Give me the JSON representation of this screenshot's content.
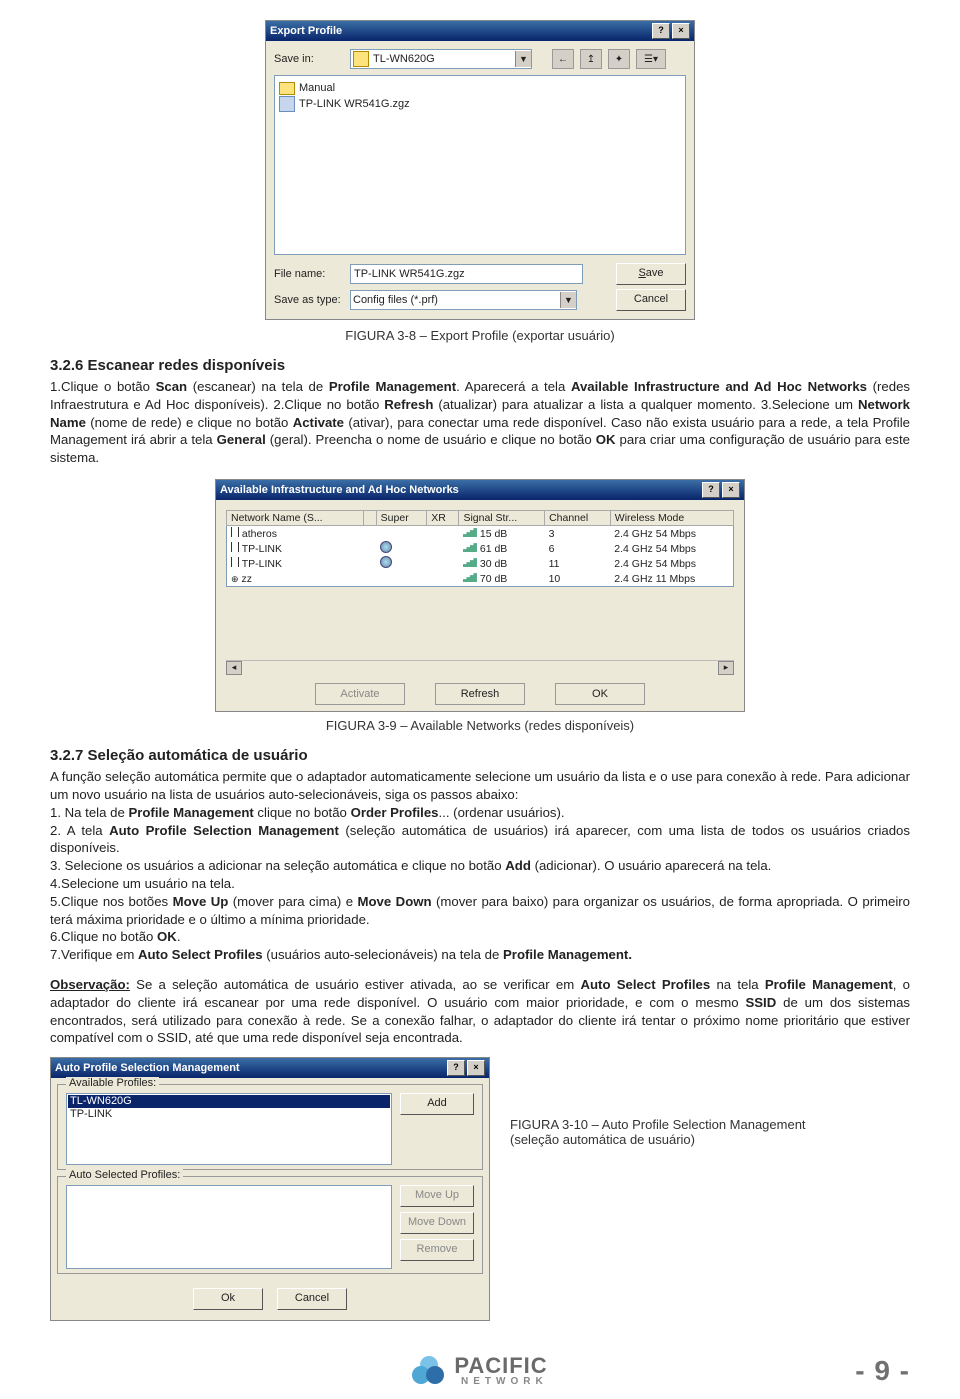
{
  "fig38": {
    "title": "Export Profile",
    "savein_label": "Save in:",
    "savein_value": "TL-WN620G",
    "files": [
      {
        "type": "folder",
        "name": "Manual"
      },
      {
        "type": "cfg",
        "name": "TP-LINK WR541G.zgz"
      }
    ],
    "filename_label": "File name:",
    "filename_value": "TP-LINK WR541G.zgz",
    "saveastype_label": "Save as type:",
    "saveastype_value": "Config files (*.prf)",
    "save_btn": "Save",
    "cancel_btn": "Cancel",
    "help_btn": "?",
    "close_btn": "×"
  },
  "caption38": "FIGURA 3-8 – Export Profile (exportar usuário)",
  "h326": "3.2.6 Escanear redes disponíveis",
  "p326": [
    "1.Clique o botão ",
    {
      "b": "Scan"
    },
    " (escanear) na tela de ",
    {
      "b": "Profile Management"
    },
    ". Aparecerá a tela ",
    {
      "b": "Available Infrastructure and Ad Hoc Networks"
    },
    " (redes Infraestrutura e Ad Hoc disponíveis).",
    " 2.Clique no botão ",
    {
      "b": "Refresh"
    },
    " (atualizar) para atualizar a lista a qualquer momento.",
    " 3.Selecione um ",
    {
      "b": "Network Name"
    },
    " (nome de rede) e clique no botão ",
    {
      "b": "Activate"
    },
    " (ativar), para conectar uma rede disponível. Caso não exista usuário para a rede, a tela Profile Management irá abrir a tela ",
    {
      "b": "General"
    },
    " (geral). Preencha o nome de usuário e clique no botão ",
    {
      "b": "OK"
    },
    " para criar uma configuração de usuário para este sistema."
  ],
  "fig39": {
    "title": "Available Infrastructure and Ad Hoc Networks",
    "cols": [
      "Network Name (S...",
      "",
      "Super",
      "XR",
      "Signal Str...",
      "Channel",
      "Wireless Mode"
    ],
    "rows": [
      {
        "name": "atheros",
        "encr": "",
        "super": "",
        "xr": "",
        "sig": "15 dB",
        "ch": "3",
        "mode": "2.4 GHz 54 Mbps",
        "icon": "ant"
      },
      {
        "name": "TP-LINK",
        "encr": "",
        "super": "o",
        "xr": "",
        "sig": "61 dB",
        "ch": "6",
        "mode": "2.4 GHz 54 Mbps",
        "icon": "ant"
      },
      {
        "name": "TP-LINK",
        "encr": "",
        "super": "o",
        "xr": "",
        "sig": "30 dB",
        "ch": "11",
        "mode": "2.4 GHz 54 Mbps",
        "icon": "ant"
      },
      {
        "name": "zz",
        "encr": "",
        "super": "",
        "xr": "",
        "sig": "70 dB",
        "ch": "10",
        "mode": "2.4 GHz 11 Mbps",
        "icon": "wep"
      }
    ],
    "activate_btn": "Activate",
    "refresh_btn": "Refresh",
    "ok_btn": "OK"
  },
  "caption39": "FIGURA 3-9 – Available Networks (redes disponíveis)",
  "h327": "3.2.7  Seleção automática de usuário",
  "p327_intro": " A função seleção automática permite que o adaptador automaticamente selecione um usuário da lista e o use para conexão à rede. Para adicionar um novo usuário na lista de usuários auto-selecionáveis, siga os passos abaixo:",
  "p327_items": [
    [
      "1. Na tela de ",
      {
        "b": "Profile Management"
      },
      " clique no botão ",
      {
        "b": "Order Profiles"
      },
      "... (ordenar usuários)."
    ],
    [
      "2. A tela ",
      {
        "b": "Auto Profile Selection Management"
      },
      " (seleção automática de usuários) irá aparecer, com uma lista de todos os usuários criados disponíveis."
    ],
    [
      "3. Selecione os usuários a adicionar na seleção automática e clique no botão ",
      {
        "b": "Add"
      },
      " (adicionar). O usuário aparecerá na tela."
    ],
    [
      "4.Selecione um usuário na tela."
    ],
    [
      "5.Clique nos botões ",
      {
        "b": "Move Up"
      },
      " (mover para cima) e ",
      {
        "b": "Move Down"
      },
      " (mover para baixo) para organizar os usuários, de forma apropriada. O primeiro terá máxima prioridade e o último a mínima prioridade."
    ],
    [
      "6.Clique no botão ",
      {
        "b": "OK"
      },
      "."
    ],
    [
      "7.Verifique em ",
      {
        "b": "Auto Select Profiles"
      },
      " (usuários auto-selecionáveis) na tela de ",
      {
        "b": "Profile Management."
      }
    ]
  ],
  "obs_label": "Observação:",
  "obs_text": [
    " Se a seleção automática de usuário estiver ativada, ao se verificar em ",
    {
      "b": "Auto Select Profiles"
    },
    " na tela ",
    {
      "b": "Profile Management"
    },
    ", o adaptador do cliente irá escanear por uma rede disponível. O usuário com maior prioridade, e com o mesmo ",
    {
      "b": "SSID"
    },
    " de um dos sistemas encontrados, será utilizado para conexão à rede. Se a conexão falhar, o adaptador do cliente irá tentar o próximo nome prioritário que estiver compatível com o SSID, até que uma rede disponível seja encontrada."
  ],
  "fig310": {
    "title": "Auto Profile Selection Management",
    "avail_lbl": "Available Profiles:",
    "avail_items": [
      "TL-WN620G",
      "TP-LINK"
    ],
    "sel_lbl": "Auto Selected Profiles:",
    "add_btn": "Add",
    "moveup_btn": "Move Up",
    "movedown_btn": "Move Down",
    "remove_btn": "Remove",
    "ok_btn": "Ok",
    "cancel_btn": "Cancel"
  },
  "caption310_l1": "FIGURA 3-10 – Auto Profile Selection Management",
  "caption310_l2": "(seleção automática de usuário)",
  "brand": "PACIFIC",
  "brand2": "NETWORK",
  "pagenum": "- 9 -"
}
